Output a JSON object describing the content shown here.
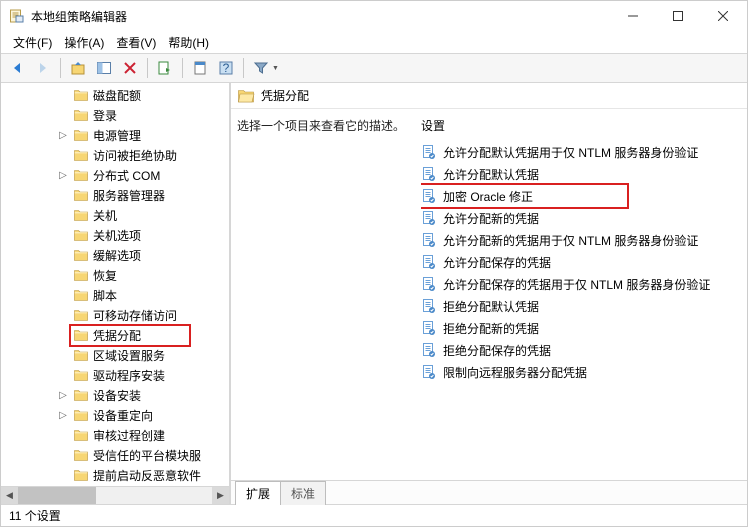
{
  "window": {
    "title": "本地组策略编辑器"
  },
  "menu": {
    "file": "文件(F)",
    "action": "操作(A)",
    "view": "查看(V)",
    "help": "帮助(H)"
  },
  "tree": {
    "items": [
      {
        "label": "磁盘配额",
        "exp": ""
      },
      {
        "label": "登录",
        "exp": ""
      },
      {
        "label": "电源管理",
        "exp": "▷"
      },
      {
        "label": "访问被拒绝协助",
        "exp": ""
      },
      {
        "label": "分布式 COM",
        "exp": "▷"
      },
      {
        "label": "服务器管理器",
        "exp": ""
      },
      {
        "label": "关机",
        "exp": ""
      },
      {
        "label": "关机选项",
        "exp": ""
      },
      {
        "label": "缓解选项",
        "exp": ""
      },
      {
        "label": "恢复",
        "exp": ""
      },
      {
        "label": "脚本",
        "exp": ""
      },
      {
        "label": "可移动存储访问",
        "exp": ""
      },
      {
        "label": "凭据分配",
        "exp": "",
        "selected": true
      },
      {
        "label": "区域设置服务",
        "exp": ""
      },
      {
        "label": "驱动程序安装",
        "exp": ""
      },
      {
        "label": "设备安装",
        "exp": "▷"
      },
      {
        "label": "设备重定向",
        "exp": "▷"
      },
      {
        "label": "审核过程创建",
        "exp": ""
      },
      {
        "label": "受信任的平台模块服",
        "exp": ""
      },
      {
        "label": "提前启动反恶意软件",
        "exp": ""
      }
    ]
  },
  "detail": {
    "heading": "凭据分配",
    "hint": "选择一个项目来查看它的描述。",
    "column": "设置",
    "items": [
      {
        "label": "允许分配默认凭据用于仅 NTLM 服务器身份验证"
      },
      {
        "label": "允许分配默认凭据"
      },
      {
        "label": "加密 Oracle 修正",
        "highlighted": true
      },
      {
        "label": "允许分配新的凭据"
      },
      {
        "label": "允许分配新的凭据用于仅 NTLM 服务器身份验证"
      },
      {
        "label": "允许分配保存的凭据"
      },
      {
        "label": "允许分配保存的凭据用于仅 NTLM 服务器身份验证"
      },
      {
        "label": "拒绝分配默认凭据"
      },
      {
        "label": "拒绝分配新的凭据"
      },
      {
        "label": "拒绝分配保存的凭据"
      },
      {
        "label": "限制向远程服务器分配凭据"
      }
    ],
    "tabs": {
      "extended": "扩展",
      "standard": "标准"
    }
  },
  "status": {
    "count": "11 个设置"
  }
}
